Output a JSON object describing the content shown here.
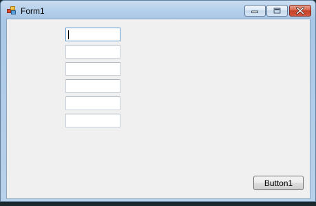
{
  "window": {
    "title": "Form1"
  },
  "titlebar_buttons": {
    "minimize_icon": "minimize-icon",
    "maximize_icon": "maximize-icon",
    "close_icon": "close-icon"
  },
  "form": {
    "textboxes": [
      {
        "value": "",
        "focused": true
      },
      {
        "value": ""
      },
      {
        "value": ""
      },
      {
        "value": ""
      },
      {
        "value": ""
      },
      {
        "value": ""
      }
    ],
    "button1_label": "Button1"
  },
  "colors": {
    "form_background": "#f0f0f0",
    "close_button": "#c5412a",
    "focus_border": "#5e9bd4"
  }
}
